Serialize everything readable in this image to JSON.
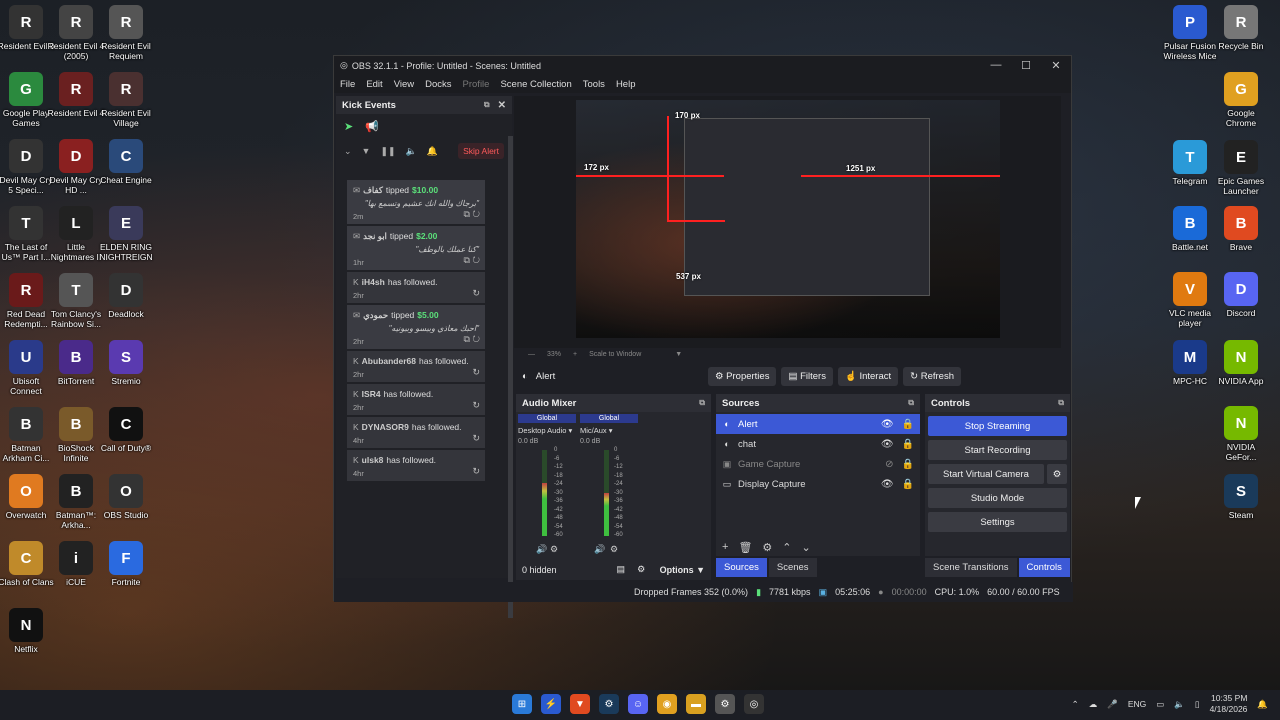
{
  "desktop": {
    "left_icons": [
      {
        "label": "Resident Evil 0",
        "color": "#333"
      },
      {
        "label": "Resident Evil 4 (2005)",
        "color": "#444"
      },
      {
        "label": "Resident Evil Requiem",
        "color": "#555"
      },
      {
        "label": "Google Play Games",
        "color": "#2b8a3e"
      },
      {
        "label": "Resident Evil 4",
        "color": "#6a2020"
      },
      {
        "label": "Resident Evil Village",
        "color": "#4a3030"
      },
      {
        "label": "Devil May Cry 5 Speci...",
        "color": "#333"
      },
      {
        "label": "Devil May Cry HD ...",
        "color": "#8a2020"
      },
      {
        "label": "Cheat Engine",
        "color": "#2a4a7a"
      },
      {
        "label": "The Last of Us™ Part I...",
        "color": "#333"
      },
      {
        "label": "Little Nightmares II",
        "color": "#222"
      },
      {
        "label": "ELDEN RING NIGHTREIGN",
        "color": "#3a3a5a"
      },
      {
        "label": "Red Dead Redempti...",
        "color": "#6a1a1a"
      },
      {
        "label": "Tom Clancy's Rainbow Si...",
        "color": "#555"
      },
      {
        "label": "Deadlock",
        "color": "#333"
      },
      {
        "label": "Ubisoft Connect",
        "color": "#2a3a8a"
      },
      {
        "label": "BitTorrent",
        "color": "#4a2a8a"
      },
      {
        "label": "Stremio",
        "color": "#5a3ab0"
      },
      {
        "label": "Batman Arkham Ci...",
        "color": "#333"
      },
      {
        "label": "BioShock Infinite",
        "color": "#7a5a2a"
      },
      {
        "label": "Call of Duty®",
        "color": "#111"
      },
      {
        "label": "Overwatch",
        "color": "#e07a20"
      },
      {
        "label": "Batman™: Arkha...",
        "color": "#222"
      },
      {
        "label": "OBS Studio",
        "color": "#333"
      },
      {
        "label": "Clash of Clans",
        "color": "#c08a2a"
      },
      {
        "label": "iCUE",
        "color": "#222"
      },
      {
        "label": "Fortnite",
        "color": "#2a6ae0"
      },
      {
        "label": "Netflix",
        "color": "#111"
      }
    ],
    "right_icons": [
      {
        "label": "Pulsar Fusion Wireless Mice",
        "color": "#2a5ad0"
      },
      {
        "label": "Recycle Bin",
        "color": "#777"
      },
      {
        "label": "Google Chrome",
        "color": "#e0a020"
      },
      {
        "label": "Telegram",
        "color": "#2a9ad8"
      },
      {
        "label": "Epic Games Launcher",
        "color": "#222"
      },
      {
        "label": "Battle.net",
        "color": "#1a6ad8"
      },
      {
        "label": "Brave",
        "color": "#e04a20"
      },
      {
        "label": "VLC media player",
        "color": "#e07a10"
      },
      {
        "label": "Discord",
        "color": "#5865f2"
      },
      {
        "label": "MPC-HC",
        "color": "#1a3a8a"
      },
      {
        "label": "NVIDIA App",
        "color": "#76b900"
      },
      {
        "label": "NVIDIA GeFor...",
        "color": "#76b900"
      },
      {
        "label": "Steam",
        "color": "#1a3a5a"
      }
    ]
  },
  "obs": {
    "title": "OBS 32.1.1 - Profile: Untitled - Scenes: Untitled",
    "menu": [
      "File",
      "Edit",
      "View",
      "Docks",
      "Profile",
      "Scene Collection",
      "Tools",
      "Help"
    ],
    "kick": {
      "title": "Kick Events",
      "skip_label": "Skip Alert",
      "events": [
        {
          "type": "tip",
          "user": "كفاف",
          "verb": "tipped",
          "amount": "$10.00",
          "message": "\"برجاك والله انك عشيم وتسمع بها\"",
          "time": "2m"
        },
        {
          "type": "tip",
          "user": "ابو نجد",
          "verb": "tipped",
          "amount": "$2.00",
          "message": "\"كنا عملك بالوطف\"",
          "time": "1hr"
        },
        {
          "type": "follow",
          "user": "iH4sh",
          "verb": "has followed.",
          "time": "2hr"
        },
        {
          "type": "tip",
          "user": "حمودي",
          "verb": "tipped",
          "amount": "$5.00",
          "message": "\"احبك معاذي وبيسو وبيونيه\"",
          "time": "2hr"
        },
        {
          "type": "follow",
          "user": "Abubander68",
          "verb": "has followed.",
          "time": "2hr"
        },
        {
          "type": "follow",
          "user": "ISR4",
          "verb": "has followed.",
          "time": "2hr"
        },
        {
          "type": "follow",
          "user": "DYNASOR9",
          "verb": "has followed.",
          "time": "4hr"
        },
        {
          "type": "follow",
          "user": "ulsk8",
          "verb": "has followed.",
          "time": "4hr"
        }
      ]
    },
    "preview": {
      "meas_top": "170 px",
      "meas_left": "172 px",
      "meas_right": "1251 px",
      "meas_bottom": "537 px",
      "zoom": "33%",
      "scale_mode": "Scale to Window"
    },
    "source_bar": {
      "selected": "Alert",
      "buttons": [
        "Properties",
        "Filters",
        "Interact",
        "Refresh"
      ]
    },
    "mixer": {
      "title": "Audio Mixer",
      "channels": [
        {
          "tag": "Global",
          "name": "Desktop Audio",
          "db": "0.0 dB",
          "level": 0.62
        },
        {
          "tag": "Global",
          "name": "Mic/Aux",
          "db": "0.0 dB",
          "level": 0.5
        }
      ],
      "scale": [
        "0",
        "-6",
        "-12",
        "-18",
        "-24",
        "-30",
        "-36",
        "-42",
        "-48",
        "-54",
        "-60"
      ],
      "hidden": "0 hidden",
      "options": "Options"
    },
    "sources": {
      "title": "Sources",
      "items": [
        {
          "name": "Alert",
          "state": "selected"
        },
        {
          "name": "chat",
          "state": "normal"
        },
        {
          "name": "Game Capture",
          "state": "hidden"
        },
        {
          "name": "Display Capture",
          "state": "normal"
        }
      ],
      "tab_sources": "Sources",
      "tab_scenes": "Scenes"
    },
    "controls": {
      "title": "Controls",
      "stop_streaming": "Stop Streaming",
      "start_recording": "Start Recording",
      "start_virtual_camera": "Start Virtual Camera",
      "studio_mode": "Studio Mode",
      "settings": "Settings",
      "tab_transitions": "Scene Transitions",
      "tab_controls": "Controls"
    },
    "status": {
      "dropped": "Dropped Frames 352 (0.0%)",
      "bitrate": "7781 kbps",
      "stream_time": "05:25:06",
      "rec_time": "00:00:00",
      "cpu": "CPU: 1.0%",
      "fps": "60.00 / 60.00 FPS"
    }
  },
  "taskbar": {
    "lang": "ENG",
    "time": "10:35 PM",
    "date": "4/18/2026"
  }
}
